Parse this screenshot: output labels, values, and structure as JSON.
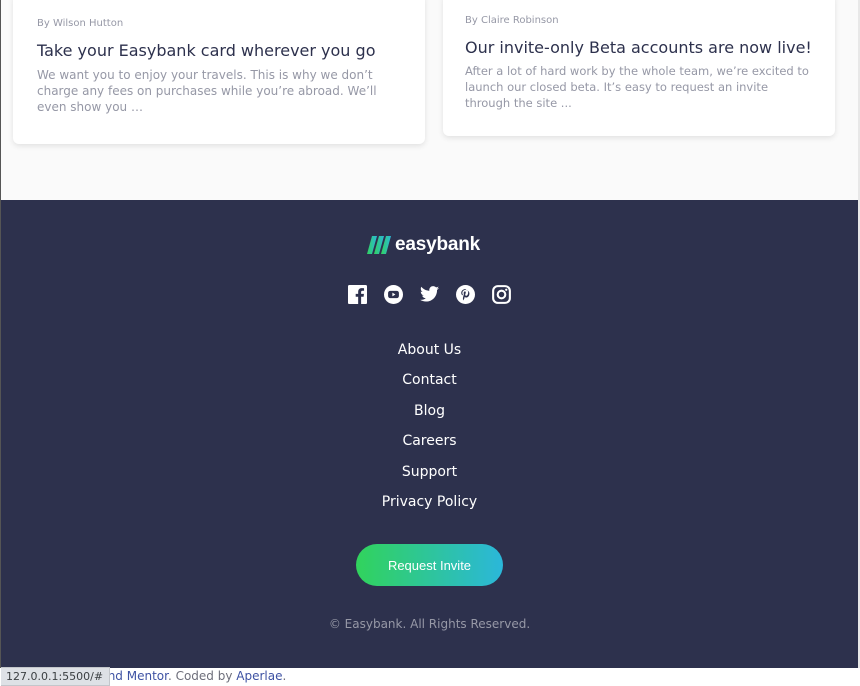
{
  "articles": [
    {
      "author": "By Wilson Hutton",
      "title": "Take your Easybank card wherever you go",
      "excerpt": "We want you to enjoy your travels. This is why we don’t charge any fees on purchases while you’re abroad. We’ll even show you …"
    },
    {
      "author": "By Claire Robinson",
      "title": "Our invite-only Beta accounts are now live!",
      "excerpt": "After a lot of hard work by the whole team, we’re excited to launch our closed beta. It’s easy to request an invite through the site ..."
    }
  ],
  "footer": {
    "logo_text": "easybank",
    "socials": [
      "facebook-icon",
      "youtube-icon",
      "twitter-icon",
      "pinterest-icon",
      "instagram-icon"
    ],
    "links": [
      "About Us",
      "Contact",
      "Blog",
      "Careers",
      "Support",
      "Privacy Policy"
    ],
    "cta_label": "Request Invite",
    "copyright": "© Easybank. All Rights Reserved."
  },
  "attribution": {
    "link1": "ntend Mentor",
    "middle": ". Coded by ",
    "link2": "Aperlae",
    "end": "."
  },
  "statusbar": {
    "url": "127.0.0.1:5500/#"
  },
  "colors": {
    "footer_bg": "#2d314d",
    "title_text": "#2d314d",
    "muted_text": "#9698a6",
    "cta_gradient_start": "#31d35c",
    "cta_gradient_end": "#2bb7da"
  }
}
